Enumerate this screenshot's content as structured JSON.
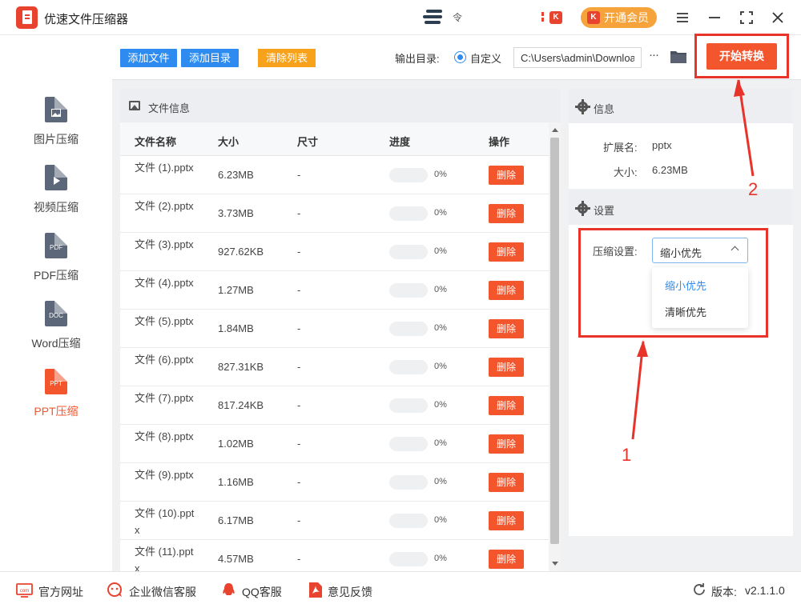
{
  "app": {
    "title": "优速文件压缩器",
    "vip_label": "开通会员",
    "vip_badge": "K",
    "notification_badge": "K",
    "wifi_symbol": "令"
  },
  "colors": {
    "accent": "#f3562d",
    "blue": "#2e8cf0",
    "orange": "#f8a21c",
    "annotation": "#e8332a"
  },
  "sidebar": {
    "items": [
      {
        "label": "图片压缩",
        "icon": "image-file-icon",
        "icon_text": "",
        "active": false
      },
      {
        "label": "视频压缩",
        "icon": "video-file-icon",
        "icon_text": "",
        "active": false
      },
      {
        "label": "PDF压缩",
        "icon": "pdf-file-icon",
        "icon_text": "PDF",
        "active": false
      },
      {
        "label": "Word压缩",
        "icon": "doc-file-icon",
        "icon_text": "DOC",
        "active": false
      },
      {
        "label": "PPT压缩",
        "icon": "ppt-file-icon",
        "icon_text": "PPT",
        "active": true
      }
    ]
  },
  "toolbar": {
    "add_file": "添加文件",
    "add_dir": "添加目录",
    "clear_list": "清除列表",
    "output_label": "输出目录:",
    "custom_label": "自定义",
    "output_path": "C:\\Users\\admin\\Downloads",
    "more": "···",
    "start": "开始转换"
  },
  "file_panel": {
    "title": "文件信息",
    "columns": [
      "文件名称",
      "大小",
      "尺寸",
      "进度",
      "操作"
    ],
    "rows": [
      {
        "name": "文件 (1).pptx",
        "size": "6.23MB",
        "dim": "-",
        "progress": "0%",
        "action": "删除"
      },
      {
        "name": "文件 (2).pptx",
        "size": "3.73MB",
        "dim": "-",
        "progress": "0%",
        "action": "删除"
      },
      {
        "name": "文件 (3).pptx",
        "size": "927.62KB",
        "dim": "-",
        "progress": "0%",
        "action": "删除"
      },
      {
        "name": "文件 (4).pptx",
        "size": "1.27MB",
        "dim": "-",
        "progress": "0%",
        "action": "删除"
      },
      {
        "name": "文件 (5).pptx",
        "size": "1.84MB",
        "dim": "-",
        "progress": "0%",
        "action": "删除"
      },
      {
        "name": "文件 (6).pptx",
        "size": "827.31KB",
        "dim": "-",
        "progress": "0%",
        "action": "删除"
      },
      {
        "name": "文件 (7).pptx",
        "size": "817.24KB",
        "dim": "-",
        "progress": "0%",
        "action": "删除"
      },
      {
        "name": "文件 (8).pptx",
        "size": "1.02MB",
        "dim": "-",
        "progress": "0%",
        "action": "删除"
      },
      {
        "name": "文件 (9).pptx",
        "size": "1.16MB",
        "dim": "-",
        "progress": "0%",
        "action": "删除"
      },
      {
        "name": "文件 (10).pptx",
        "size": "6.17MB",
        "dim": "-",
        "progress": "0%",
        "action": "删除"
      },
      {
        "name": "文件 (11).pptx",
        "size": "4.57MB",
        "dim": "-",
        "progress": "0%",
        "action": "删除"
      }
    ]
  },
  "info": {
    "title": "信息",
    "ext_label": "扩展名:",
    "ext_value": "pptx",
    "size_label": "大小:",
    "size_value": "6.23MB"
  },
  "settings": {
    "title": "设置",
    "compress_label": "压缩设置:",
    "selected": "缩小优先",
    "options": [
      "缩小优先",
      "清晰优先"
    ]
  },
  "annotations": {
    "num1": "1",
    "num2": "2"
  },
  "footer": {
    "website": "官方网址",
    "wechat": "企业微信客服",
    "qq": "QQ客服",
    "feedback": "意见反馈",
    "version_label": "版本:",
    "version": "v2.1.1.0"
  }
}
